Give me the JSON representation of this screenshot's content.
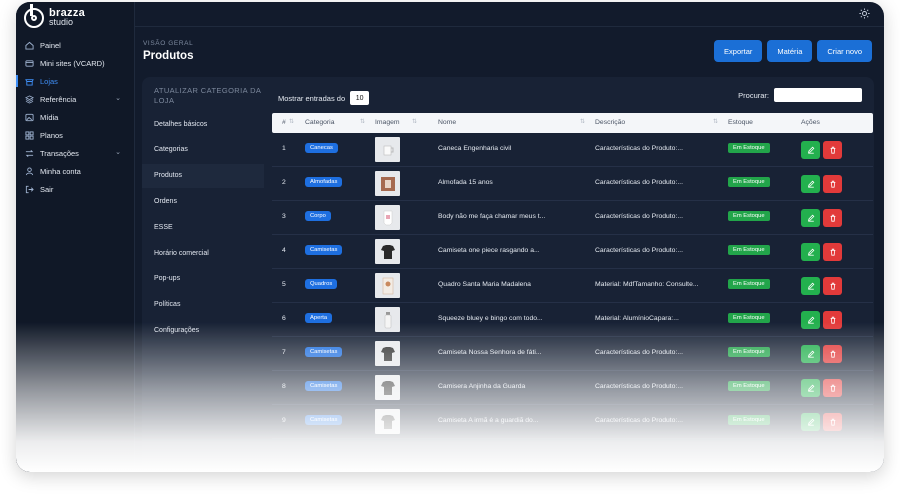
{
  "brand": {
    "name": "brazza",
    "sub": "studio"
  },
  "sidebar": {
    "items": [
      {
        "label": "Painel",
        "icon": "home-icon"
      },
      {
        "label": "Mini sites (VCARD)",
        "icon": "card-icon"
      },
      {
        "label": "Lojas",
        "icon": "store-icon",
        "active": true
      },
      {
        "label": "Referência",
        "icon": "layers-icon",
        "chevron": true
      },
      {
        "label": "Mídia",
        "icon": "image-icon"
      },
      {
        "label": "Planos",
        "icon": "grid-icon"
      },
      {
        "label": "Transações",
        "icon": "swap-icon",
        "chevron": true
      },
      {
        "label": "Minha conta",
        "icon": "user-icon"
      },
      {
        "label": "Sair",
        "icon": "logout-icon"
      }
    ]
  },
  "header": {
    "breadcrumb": "VISÃO GERAL",
    "title": "Produtos"
  },
  "actions": {
    "export": "Exportar",
    "material": "Matéria",
    "create": "Criar novo"
  },
  "subnav": {
    "heading": "ATUALIZAR CATEGORIA DA LOJA",
    "items": [
      "Detalhes básicos",
      "Categorias",
      "Produtos",
      "Ordens",
      "ESSE",
      "Horário comercial",
      "Pop-ups",
      "Políticas",
      "Configurações"
    ],
    "active_index": 2
  },
  "table_controls": {
    "show_label": "Mostrar entradas do",
    "show_value": "10",
    "search_label": "Procurar:",
    "search_value": ""
  },
  "table": {
    "columns": [
      "#",
      "Categoria",
      "Imagem",
      "Nome",
      "Descrição",
      "Estoque",
      "Ações"
    ],
    "rows": [
      {
        "num": "1",
        "category": "Canecas",
        "name": "Caneca Engenharia civil",
        "description": "Características do Produto:...",
        "stock": "Em Estoque"
      },
      {
        "num": "2",
        "category": "Almofadas",
        "name": "Almofada 15 anos",
        "description": "Características do Produto:...",
        "stock": "Em Estoque"
      },
      {
        "num": "3",
        "category": "Corpo",
        "name": "Body não me faça chamar meus t...",
        "description": "Características do Produto:...",
        "stock": "Em Estoque"
      },
      {
        "num": "4",
        "category": "Camisetas",
        "name": "Camiseta one piece rasgando a...",
        "description": "Características do Produto:...",
        "stock": "Em Estoque"
      },
      {
        "num": "5",
        "category": "Quadros",
        "name": "Quadro Santa Maria Madalena",
        "description": "Material: MdfTamanho: Consulte...",
        "stock": "Em Estoque"
      },
      {
        "num": "6",
        "category": "Aperta",
        "name": "Squeeze bluey e bingo com todo...",
        "description": "Material: AlumínioCapara:...",
        "stock": "Em Estoque"
      },
      {
        "num": "7",
        "category": "Camisetas",
        "name": "Camiseta Nossa Senhora de fáti...",
        "description": "Características do Produto:...",
        "stock": "Em Estoque"
      },
      {
        "num": "8",
        "category": "Camisetas",
        "name": "Camisera Anjinha da Guarda",
        "description": "Características do Produto:...",
        "stock": "Em Estoque"
      },
      {
        "num": "9",
        "category": "Camisetas",
        "name": "Camiseta A irmã é a guardiã do...",
        "description": "Características do Produto:...",
        "stock": "Em Estoque"
      }
    ]
  },
  "colors": {
    "accent": "#1b6fd6",
    "stock": "#22a54a",
    "edit": "#23b04e",
    "delete": "#e23a3a",
    "bg": "#121b2c"
  }
}
